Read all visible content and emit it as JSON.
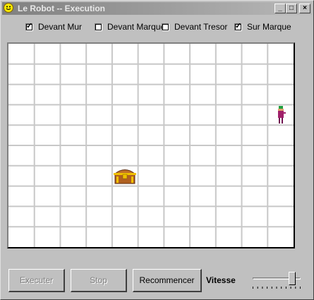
{
  "window": {
    "title": "Le Robot -- Execution",
    "controls": {
      "minimize": "_",
      "maximize": "□",
      "close": "×"
    }
  },
  "checkboxes": [
    {
      "label": "Devant Mur",
      "checked": true
    },
    {
      "label": "Devant Marque",
      "checked": false
    },
    {
      "label": "Devant Tresor",
      "checked": false
    },
    {
      "label": "Sur Marque",
      "checked": true
    }
  ],
  "grid": {
    "columns": 11,
    "rows": 10,
    "robot": {
      "col": 10,
      "row": 3,
      "icon": "robot-icon"
    },
    "treasure": {
      "col": 4,
      "row": 6,
      "icon": "treasure-chest-icon"
    }
  },
  "buttons": {
    "execute": {
      "label": "Executer",
      "enabled": false
    },
    "stop": {
      "label": "Stop",
      "enabled": false
    },
    "restart": {
      "label": "Recommencer",
      "enabled": true
    }
  },
  "speed": {
    "label": "Vitesse",
    "value": 0.82
  },
  "colors": {
    "title_gradient_start": "#808080",
    "title_gradient_end": "#b8b8b8",
    "grid_line": "#c8c8c8",
    "robot_body": "#a0206a",
    "robot_head": "#20a040",
    "chest_wood": "#b06020",
    "chest_gold": "#f0c000"
  }
}
